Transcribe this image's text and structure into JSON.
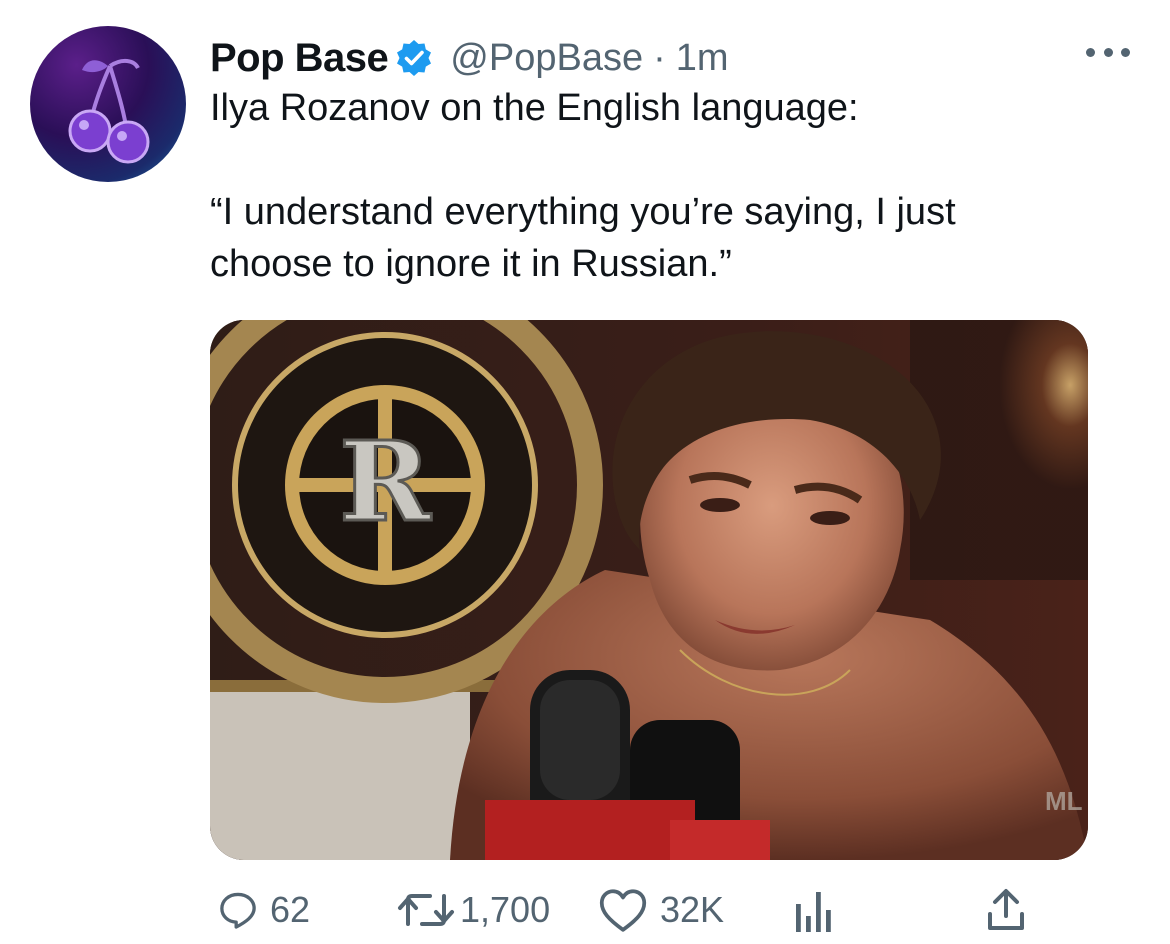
{
  "author": {
    "display_name": "Pop Base",
    "handle": "@PopBase",
    "separator": "·",
    "time": "1m",
    "verified": true,
    "avatar_icon": "cherry-icon"
  },
  "tweet": {
    "line1": "Ilya Rozanov on the English language:",
    "quote_line1": "“I understand everything you’re saying, I just",
    "quote_line2": "choose to ignore it in Russian.”"
  },
  "media": {
    "logo_letter": "R",
    "corner_text": "ML"
  },
  "actions": {
    "reply_count": "62",
    "retweet_count": "1,700",
    "like_count": "32K",
    "analytics_icon": "bar-chart-icon",
    "share_icon": "share-icon"
  },
  "colors": {
    "text_primary": "#0f1419",
    "text_secondary": "#536471",
    "verified_blue": "#1d9bf0"
  }
}
